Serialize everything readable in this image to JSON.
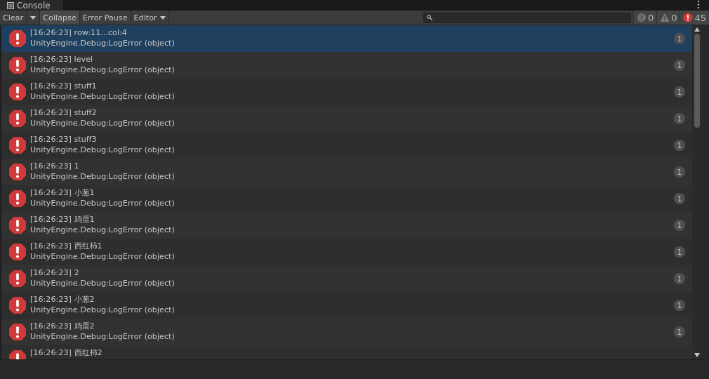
{
  "tab": {
    "title": "Console",
    "selected": true
  },
  "toolbar": [
    {
      "label": "Clear",
      "kind": "dropdown-split",
      "on": false
    },
    {
      "label": "Collapse",
      "kind": "toggle",
      "on": true
    },
    {
      "label": "Error Pause",
      "kind": "toggle",
      "on": false
    },
    {
      "label": "Editor",
      "kind": "dropdown",
      "on": false
    }
  ],
  "counters": [
    {
      "kind": "info",
      "count": "0"
    },
    {
      "kind": "warning",
      "count": "0"
    },
    {
      "kind": "error",
      "count": "45"
    }
  ],
  "entries": [
    {
      "message": "[16:26:23] row:11...col:4",
      "source": "UnityEngine.Debug:LogError (object)",
      "count": "1",
      "selected": true
    },
    {
      "message": "[16:26:23] level",
      "source": "UnityEngine.Debug:LogError (object)",
      "count": "1",
      "selected": false
    },
    {
      "message": "[16:26:23] stuff1",
      "source": "UnityEngine.Debug:LogError (object)",
      "count": "1",
      "selected": false
    },
    {
      "message": "[16:26:23] stuff2",
      "source": "UnityEngine.Debug:LogError (object)",
      "count": "1",
      "selected": false
    },
    {
      "message": "[16:26:23] stuff3",
      "source": "UnityEngine.Debug:LogError (object)",
      "count": "1",
      "selected": false
    },
    {
      "message": "[16:26:23] 1",
      "source": "UnityEngine.Debug:LogError (object)",
      "count": "1",
      "selected": false
    },
    {
      "message": "[16:26:23] 小葱1",
      "source": "UnityEngine.Debug:LogError (object)",
      "count": "1",
      "selected": false
    },
    {
      "message": "[16:26:23] 鸡蛋1",
      "source": "UnityEngine.Debug:LogError (object)",
      "count": "1",
      "selected": false
    },
    {
      "message": "[16:26:23] 西红柿1",
      "source": "UnityEngine.Debug:LogError (object)",
      "count": "1",
      "selected": false
    },
    {
      "message": "[16:26:23] 2",
      "source": "UnityEngine.Debug:LogError (object)",
      "count": "1",
      "selected": false
    },
    {
      "message": "[16:26:23] 小葱2",
      "source": "UnityEngine.Debug:LogError (object)",
      "count": "1",
      "selected": false
    },
    {
      "message": "[16:26:23] 鸡蛋2",
      "source": "UnityEngine.Debug:LogError (object)",
      "count": "1",
      "selected": false
    },
    {
      "message": "[16:26:23] 西红柿2",
      "selected": false
    }
  ]
}
